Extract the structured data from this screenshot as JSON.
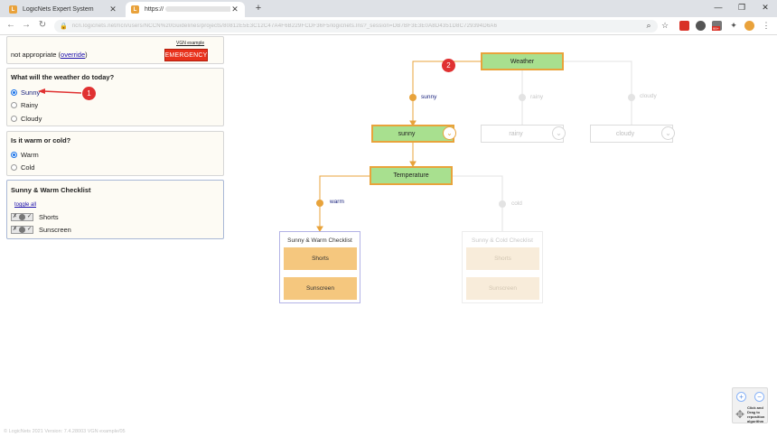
{
  "browser": {
    "tabs": [
      {
        "title": "LogicNets Expert System",
        "active": false
      },
      {
        "title": "https://",
        "active": true
      }
    ],
    "url": "ncn.logicnets.net/ncn/users/NCCN%20Guidelines/projects/80812E5E3C12C47A4F6B229FCDF36F5/logicnets.lns?_session=DB7BF3E3E0A8D4351D8C729394D6A6",
    "extension_badge": "99+"
  },
  "colors": {
    "active_node_fill": "#a8e08f",
    "active_node_border": "#e8a33b",
    "path_line": "#e8a33b",
    "emergency": "#e8321c",
    "callout": "#e03131"
  },
  "header": {
    "vgn_link": "VGN example",
    "not_appropriate_prefix": "not appropriate (",
    "override_link": "override",
    "not_appropriate_suffix": ")",
    "emergency_button": "EMERGENCY"
  },
  "weather_question": {
    "title": "What will the weather do today?",
    "options": [
      {
        "label": "Sunny",
        "checked": true
      },
      {
        "label": "Rainy",
        "checked": false
      },
      {
        "label": "Cloudy",
        "checked": false
      }
    ]
  },
  "temperature_question": {
    "title": "Is it warm or cold?",
    "options": [
      {
        "label": "Warm",
        "checked": true
      },
      {
        "label": "Cold",
        "checked": false
      }
    ]
  },
  "checklist": {
    "title": "Sunny & Warm Checklist",
    "toggle_all": "toggle all",
    "tristate_no": "✗",
    "tristate_yes": "✓",
    "items": [
      "Shorts",
      "Sunscreen"
    ]
  },
  "callouts": [
    "1",
    "2"
  ],
  "diagram": {
    "root": "Weather",
    "edges": {
      "sunny": "sunny",
      "rainy": "rainy",
      "cloudy": "cloudy",
      "warm": "warm",
      "cold": "cold"
    },
    "branch_nodes": {
      "sunny": "sunny",
      "rainy": "rainy",
      "cloudy": "cloudy"
    },
    "temperature_node": "Temperature",
    "chevron": "⌄",
    "warm_checklist": {
      "title": "Sunny & Warm Checklist",
      "items": [
        "Shorts",
        "Sunscreen"
      ]
    },
    "cold_checklist": {
      "title": "Sunny & Cold Checklist",
      "items": [
        "Shorts",
        "Sunscreen"
      ]
    }
  },
  "zoom": {
    "zoom_in": "+",
    "zoom_out": "−",
    "help_line1": "Click and",
    "help_line2": "Drag to",
    "help_line3": "reposition",
    "help_line4": "algorithm"
  },
  "footer": "© LogicNets 2021     Version: 7.4.28003 VGN example/05"
}
